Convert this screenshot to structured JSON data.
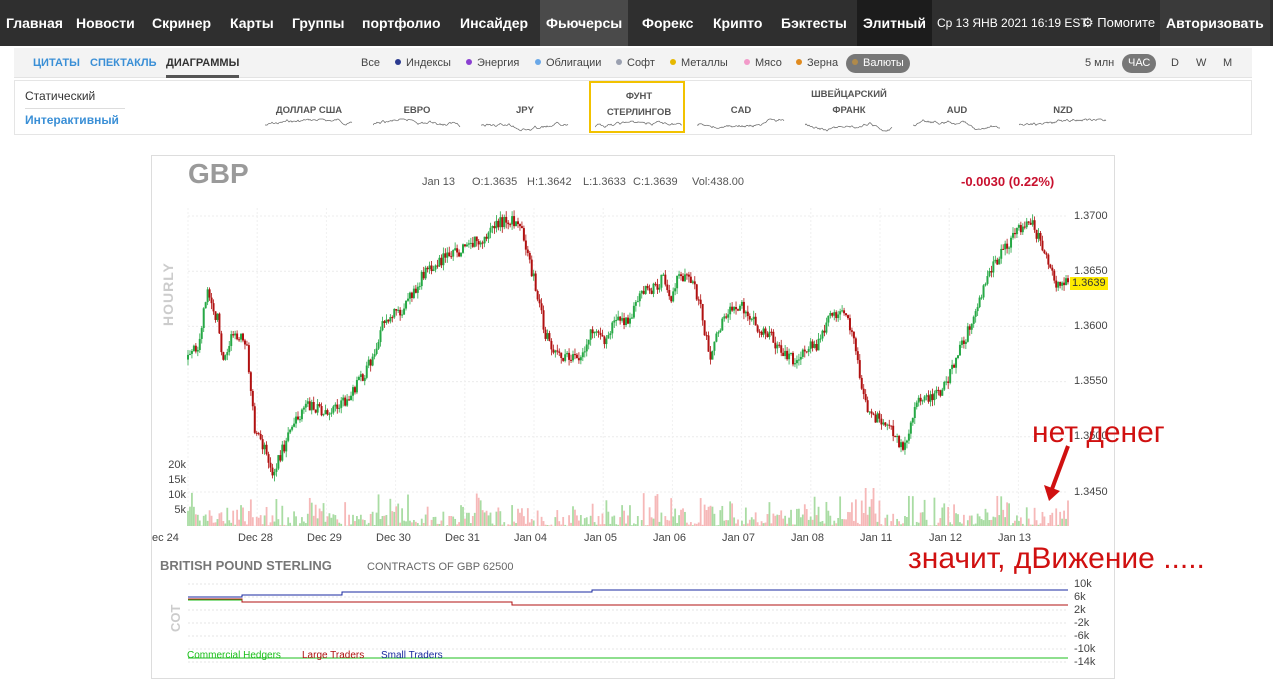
{
  "nav": {
    "items": [
      "Главная",
      "Новости",
      "Скринер",
      "Карты",
      "Группы",
      "портфолио",
      "Инсайдер",
      "Фьючерсы",
      "Форекс",
      "Крипто",
      "Бэктесты",
      "Элитный"
    ],
    "datetime": "Ср 13 ЯНВ 2021 16:19 EST",
    "help": "Помогите",
    "login": "Авторизовать"
  },
  "toolbar": {
    "tabs": [
      "ЦИТАТЫ",
      "СПЕКТАКЛЬ",
      "ДИАГРАММЫ"
    ],
    "categories": [
      {
        "label": "Все",
        "color": ""
      },
      {
        "label": "Индексы",
        "color": "#2b3a8f"
      },
      {
        "label": "Энергия",
        "color": "#8a3fd1"
      },
      {
        "label": "Облигации",
        "color": "#6aa8e8"
      },
      {
        "label": "Софт",
        "color": "#9aa0b0"
      },
      {
        "label": "Металлы",
        "color": "#e6b800"
      },
      {
        "label": "Мясо",
        "color": "#f29ac9"
      },
      {
        "label": "Зерна",
        "color": "#e08a1e"
      },
      {
        "label": "Валюты",
        "color": "#b08a4a"
      }
    ],
    "timeframes": [
      "5 млн",
      "ЧАС",
      "D",
      "W",
      "M"
    ]
  },
  "panel": {
    "modes": [
      "Статический",
      "Интерактивный"
    ],
    "currencies": [
      {
        "l1": "",
        "l2": "ДОЛЛАР США"
      },
      {
        "l1": "",
        "l2": "ЕВРО"
      },
      {
        "l1": "",
        "l2": "JPY"
      },
      {
        "l1": "ФУНТ",
        "l2": "СТЕРЛИНГОВ"
      },
      {
        "l1": "",
        "l2": "CAD"
      },
      {
        "l1": "ШВЕЙЦАРСКИЙ",
        "l2": "ФРАНК"
      },
      {
        "l1": "",
        "l2": "AUD"
      },
      {
        "l1": "",
        "l2": "NZD"
      }
    ]
  },
  "chart": {
    "symbol": "GBP",
    "date": "Jan 13",
    "open": "O:1.3635",
    "high": "H:1.3642",
    "low": "L:1.3633",
    "close": "C:1.3639",
    "vol": "Vol:438.00",
    "change": "-0.0030 (0.22%)",
    "last": "1.3639",
    "period_label": "HOURLY"
  },
  "chart_data": {
    "type": "candlestick",
    "yticks": [
      "1.3700",
      "1.3650",
      "1.3600",
      "1.3550",
      "1.3500",
      "1.3450"
    ],
    "volume_ticks": [
      "20k",
      "15k",
      "10k",
      "5k"
    ],
    "xticks": [
      "ec 24",
      "Dec 28",
      "Dec 29",
      "Dec 30",
      "Dec 31",
      "Jan 04",
      "Jan 05",
      "Jan 06",
      "Jan 07",
      "Jan 08",
      "Jan 11",
      "Jan 12",
      "Jan 13"
    ],
    "ylim": [
      1.3425,
      1.371
    ],
    "path": [
      [
        0,
        1.356
      ],
      [
        5,
        1.3575
      ],
      [
        10,
        1.3625
      ],
      [
        15,
        1.36
      ],
      [
        18,
        1.3555
      ],
      [
        22,
        1.358
      ],
      [
        26,
        1.3585
      ],
      [
        30,
        1.357
      ],
      [
        34,
        1.349
      ],
      [
        38,
        1.3475
      ],
      [
        43,
        1.345
      ],
      [
        48,
        1.347
      ],
      [
        55,
        1.35
      ],
      [
        62,
        1.3515
      ],
      [
        70,
        1.3505
      ],
      [
        80,
        1.352
      ],
      [
        88,
        1.354
      ],
      [
        95,
        1.3565
      ],
      [
        100,
        1.36
      ],
      [
        110,
        1.361
      ],
      [
        120,
        1.3645
      ],
      [
        130,
        1.366
      ],
      [
        140,
        1.367
      ],
      [
        150,
        1.368
      ],
      [
        162,
        1.37
      ],
      [
        170,
        1.369
      ],
      [
        176,
        1.364
      ],
      [
        182,
        1.3585
      ],
      [
        188,
        1.3565
      ],
      [
        194,
        1.356
      ],
      [
        200,
        1.356
      ],
      [
        206,
        1.359
      ],
      [
        212,
        1.3575
      ],
      [
        218,
        1.36
      ],
      [
        224,
        1.3595
      ],
      [
        230,
        1.3625
      ],
      [
        236,
        1.363
      ],
      [
        242,
        1.364
      ],
      [
        246,
        1.3615
      ],
      [
        250,
        1.3645
      ],
      [
        256,
        1.364
      ],
      [
        260,
        1.362
      ],
      [
        266,
        1.356
      ],
      [
        272,
        1.36
      ],
      [
        278,
        1.3615
      ],
      [
        284,
        1.361
      ],
      [
        290,
        1.359
      ],
      [
        296,
        1.3585
      ],
      [
        302,
        1.3565
      ],
      [
        308,
        1.356
      ],
      [
        314,
        1.357
      ],
      [
        320,
        1.3575
      ],
      [
        326,
        1.36
      ],
      [
        332,
        1.361
      ],
      [
        338,
        1.359
      ],
      [
        342,
        1.3545
      ],
      [
        346,
        1.351
      ],
      [
        352,
        1.35
      ],
      [
        358,
        1.349
      ],
      [
        364,
        1.347
      ],
      [
        370,
        1.3515
      ],
      [
        376,
        1.352
      ],
      [
        382,
        1.3525
      ],
      [
        388,
        1.3545
      ],
      [
        394,
        1.3575
      ],
      [
        400,
        1.36
      ],
      [
        406,
        1.364
      ],
      [
        412,
        1.366
      ],
      [
        418,
        1.3675
      ],
      [
        424,
        1.369
      ],
      [
        430,
        1.3695
      ],
      [
        434,
        1.3675
      ],
      [
        438,
        1.3655
      ],
      [
        442,
        1.3635
      ],
      [
        448,
        1.3639
      ]
    ]
  },
  "cot": {
    "title": "BRITISH POUND STERLING",
    "contracts": "CONTRACTS OF GBP 62500",
    "yticks": [
      "10k",
      "6k",
      "2k",
      "-2k",
      "-6k",
      "-10k",
      "-14k"
    ],
    "legend": [
      {
        "label": "Commercial Hedgers",
        "color": "#1cbf1c"
      },
      {
        "label": "Large Traders",
        "color": "#b01010"
      },
      {
        "label": "Small Traders",
        "color": "#1a2aa0"
      }
    ],
    "label": "COT"
  },
  "annotations": {
    "note1": "нет денег",
    "note2": "значит, дВижение ....."
  },
  "colors": {
    "up": "#26a845",
    "down": "#b01010",
    "vol_up": "#a9dca3",
    "vol_down": "#f6b8b8",
    "accent": "#3a8fd6"
  }
}
